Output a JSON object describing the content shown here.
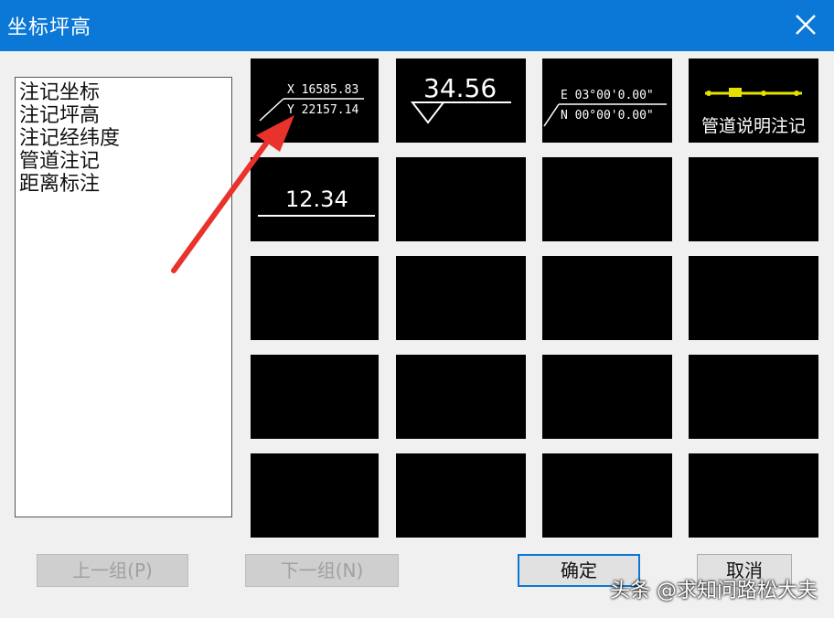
{
  "dialog": {
    "title": "坐标坪高",
    "close_icon": "close-icon"
  },
  "list": {
    "items": [
      "注记坐标",
      "注记坪高",
      "注记经纬度",
      "管道注记",
      "距离标注"
    ]
  },
  "tiles": {
    "coord": {
      "x_text": "X 16585.83",
      "y_text": "Y 22157.14"
    },
    "elev": {
      "value": "34.56"
    },
    "lonlat": {
      "e_text": "E 03°00'0.00\"",
      "n_text": "N 00°00'0.00\""
    },
    "pipe": {
      "label": "管道说明注记"
    },
    "dist": {
      "value": "12.34"
    }
  },
  "buttons": {
    "prev": "上一组(P)",
    "next": "下一组(N)",
    "ok": "确定",
    "cancel": "取消"
  },
  "watermark": "头条 @求知问路松大夫",
  "colors": {
    "titlebar": "#0b78d7",
    "arrow": "#e8322b",
    "pipe_line": "#e6e000"
  }
}
